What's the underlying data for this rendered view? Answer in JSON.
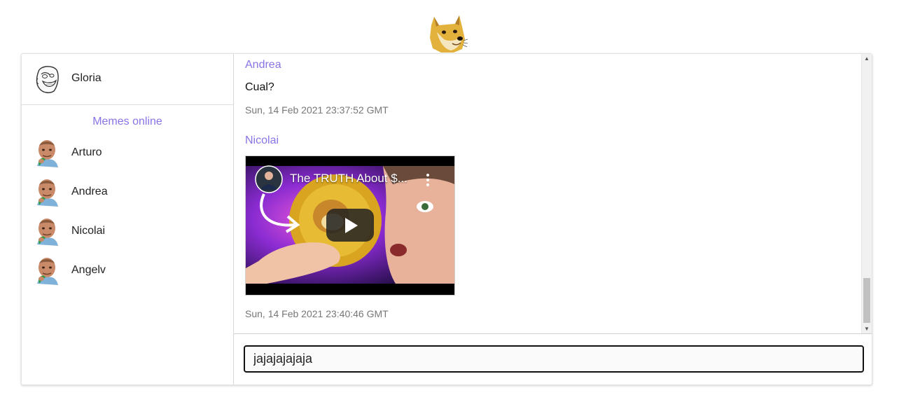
{
  "current_user": {
    "name": "Gloria"
  },
  "online": {
    "title": "Memes online",
    "users": [
      {
        "name": "Arturo"
      },
      {
        "name": "Andrea"
      },
      {
        "name": "Nicolai"
      },
      {
        "name": "Angelv"
      }
    ]
  },
  "messages": [
    {
      "author": "Andrea",
      "text": "Cual?",
      "time": "Sun, 14 Feb 2021 23:37:52 GMT"
    },
    {
      "author": "Nicolai",
      "video_title": "The TRUTH About $...",
      "time": "Sun, 14 Feb 2021 23:40:46 GMT"
    }
  ],
  "composer": {
    "value": "jajajajajaja"
  },
  "colors": {
    "accent": "#8a73e6",
    "youtube_play": "#212121"
  },
  "icons": {
    "logo": "doge-logo-icon",
    "me_avatar": "troll-face-icon",
    "user_avatar": "success-kid-icon",
    "video_menu": "more-vert-icon",
    "video_play": "play-icon"
  }
}
